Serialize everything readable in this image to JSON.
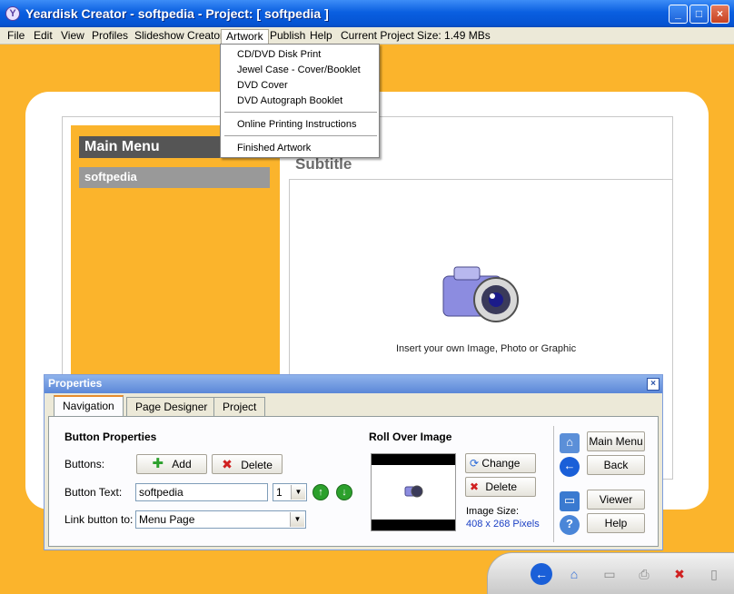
{
  "window": {
    "title": "Yeardisk Creator - softpedia - Project: [ softpedia ]",
    "app_icon_letter": "Y",
    "minimize": "_",
    "maximize": "□",
    "close": "×"
  },
  "menu": {
    "file": "File",
    "edit": "Edit",
    "view": "View",
    "profiles": "Profiles",
    "slideshow": "Slideshow Creator",
    "artwork": "Artwork",
    "publish": "Publish",
    "help": "Help",
    "project_size": "Current Project Size: 1.49 MBs"
  },
  "artwork_menu": {
    "cd_print": "CD/DVD Disk Print",
    "jewel_case": "Jewel Case - Cover/Booklet",
    "dvd_cover": "DVD Cover",
    "dvd_autograph": "DVD Autograph Booklet",
    "online_printing": "Online Printing Instructions",
    "finished": "Finished Artwork"
  },
  "preview": {
    "main_menu": "Main Menu",
    "menu_button": "softpedia",
    "subtitle": "Subtitle",
    "insert_text": "Insert your own Image, Photo or Graphic"
  },
  "properties": {
    "title": "Properties",
    "close": "×",
    "tabs": {
      "navigation": "Navigation",
      "page_designer": "Page Designer",
      "project": "Project"
    },
    "button_properties": "Button Properties",
    "buttons_label": "Buttons:",
    "add": "Add",
    "delete": "Delete",
    "button_text_label": "Button Text:",
    "button_text_value": "softpedia",
    "order_value": "1",
    "link_label": "Link button to:",
    "link_value": "Menu Page",
    "rollover_title": "Roll Over Image",
    "change": "Change",
    "delete_image": "Delete",
    "image_size_label": "Image Size:",
    "image_size_value": "408 x 268 Pixels",
    "main_menu_btn": "Main Menu",
    "back_btn": "Back",
    "viewer_btn": "Viewer",
    "help_btn": "Help"
  },
  "colors": {
    "background": "#fbb42c",
    "titlebar": "#0553d2",
    "link_blue": "#1a3fc4"
  }
}
